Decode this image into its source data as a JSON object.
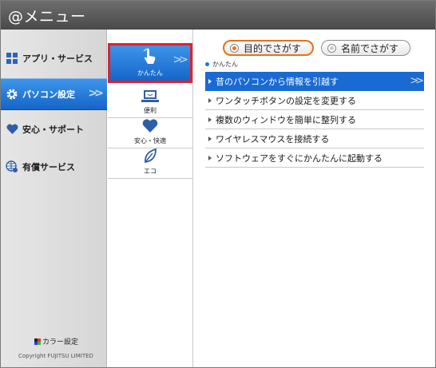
{
  "window": {
    "title": "@メニュー"
  },
  "sidebar": {
    "items": [
      {
        "label": "アプリ・サービス",
        "icon": "apps-grid-icon"
      },
      {
        "label": "パソコン設定",
        "icon": "gear-icon",
        "active": true
      },
      {
        "label": "安心・サポート",
        "icon": "heart-icon"
      },
      {
        "label": "有償サービス",
        "icon": "globe-icon"
      }
    ],
    "color_setting_label": "カラー設定",
    "copyright": "Copyright FUJITSU LIMITED"
  },
  "categories": [
    {
      "label": "かんたん",
      "icon": "hand-pointer-icon",
      "active": true
    },
    {
      "label": "便利",
      "icon": "laptop-smile-icon"
    },
    {
      "label": "安心・快適",
      "icon": "heart-icon"
    },
    {
      "label": "エコ",
      "icon": "leaf-icon"
    }
  ],
  "search_modes": [
    {
      "label": "目的でさがす",
      "active": true
    },
    {
      "label": "名前でさがす",
      "active": false
    }
  ],
  "breadcrumb": "かんたん",
  "tasks": [
    {
      "label": "昔のパソコンから情報を引越す",
      "active": true
    },
    {
      "label": "ワンタッチボタンの設定を変更する"
    },
    {
      "label": "複数のウィンドウを簡単に整列する"
    },
    {
      "label": "ワイヤレスマウスを接続する"
    },
    {
      "label": "ソフトウェアをすぐにかんたんに起動する"
    }
  ],
  "colors": {
    "accent": "#1a6ad4",
    "highlight": "#e2202c",
    "radio_active": "#e8701c"
  }
}
